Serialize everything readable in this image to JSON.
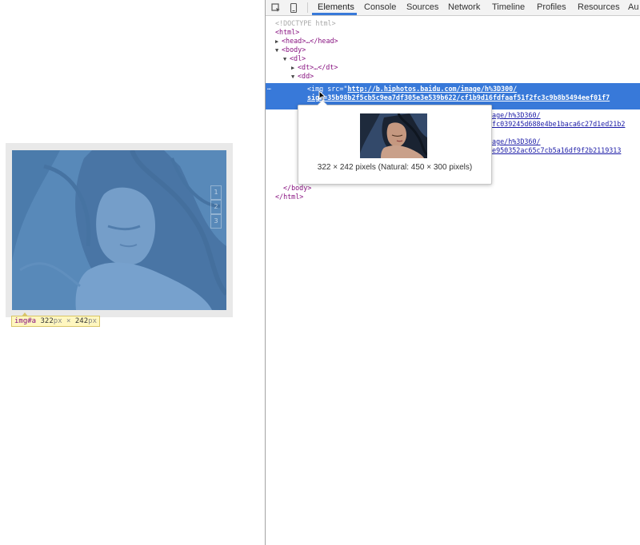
{
  "page": {
    "pager_items": [
      "1",
      "2",
      "3"
    ],
    "size_tip": {
      "tag": "img#a",
      "width": "322",
      "height": "242",
      "unit": "px",
      "times": "×"
    }
  },
  "devtools": {
    "tabs": [
      "Elements",
      "Console",
      "Sources",
      "Network",
      "Timeline",
      "Profiles",
      "Resources",
      "Au"
    ],
    "active_tab": "Elements",
    "dom": {
      "doctype": "<!DOCTYPE html>",
      "html_open": "<html>",
      "head": "<head>…</head>",
      "body_open": "<body>",
      "dl_open": "<dl>",
      "dt": "<dt>…</dt>",
      "dd_open": "<dd>",
      "selected_tag": "<img",
      "selected_attr": "src=",
      "selected_url_1": "http://b.hiphotos.baidu.com/image/h%3D300/",
      "selected_url_2": "sign=35b98b2f5cb5c9ea7df305e3e539b622/cf1b9d16fdfaaf51f2fc3c9b8b5494eef01f7",
      "line2_url_1": "mage/h%3D360/",
      "line2_url_2": "dfc039245d688e4be1baca6c27d1ed21b2",
      "line3_url_1": "mage/h%3D360/",
      "line3_url_2": "7e950352ac65c7cb5a16df9f2b2119313",
      "body_close": "</body>",
      "html_close": "</html>",
      "dots": "…"
    },
    "popover": {
      "caption": "322 × 242 pixels (Natural: 450 × 300 pixels)"
    }
  },
  "colors": {
    "selection": "#3879d9",
    "highlight": "#6fa8dc",
    "tag": "#881280",
    "attr_value": "#1a1aa6"
  },
  "icons": [
    "inspect-element-icon",
    "device-mode-icon",
    "expand-triangle-icon",
    "collapse-triangle-icon",
    "mouse-cursor-icon"
  ]
}
